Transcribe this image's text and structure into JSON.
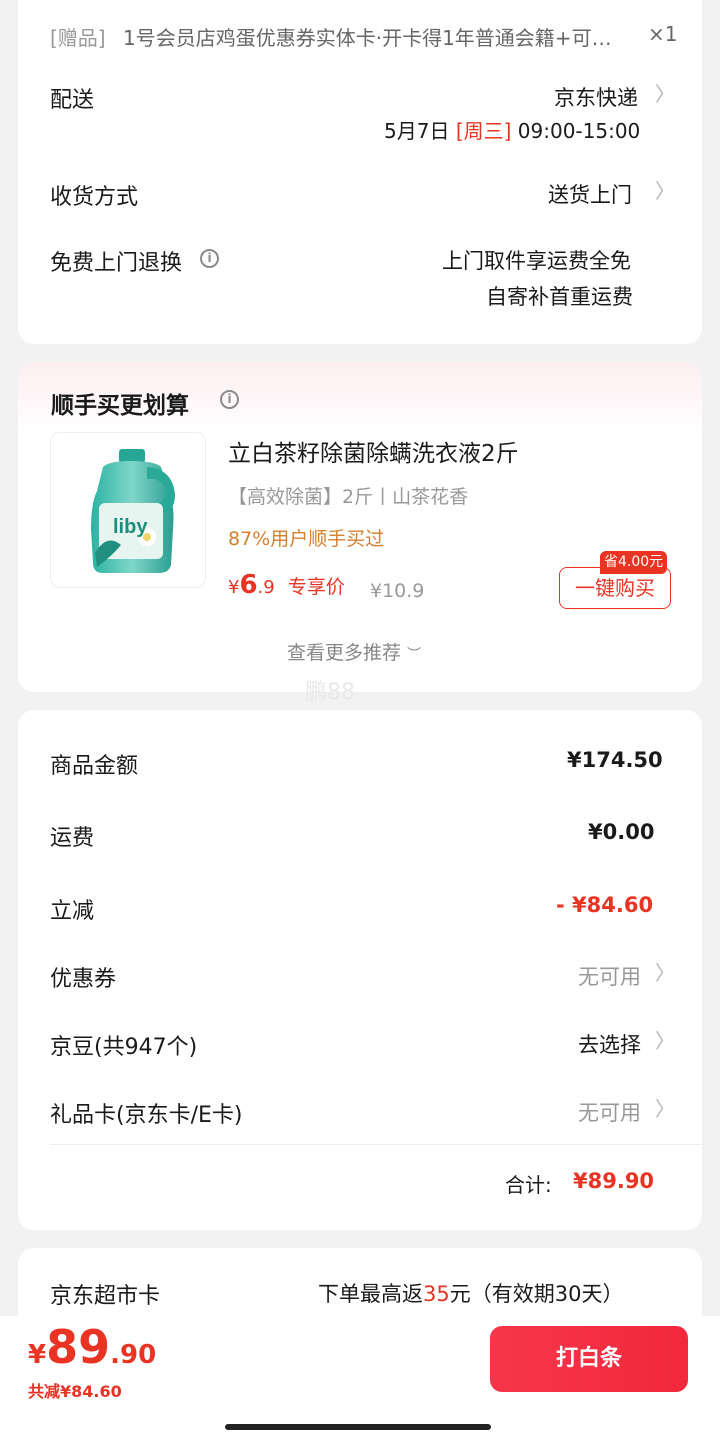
{
  "gift": {
    "tag": "[赠品]",
    "text": "1号会员店鸡蛋优惠券实体卡·开卡得1年普通会籍+可…",
    "qty": "×1"
  },
  "delivery": {
    "label": "配送",
    "carrier": "京东快递",
    "date": "5月7日",
    "weekday": "[周三]",
    "time": "09:00-15:00"
  },
  "receive": {
    "label": "收货方式",
    "value": "送货上门"
  },
  "free_return": {
    "label": "免费上门退换",
    "line1": "上门取件享运费全免",
    "line2": "自寄补首重运费"
  },
  "upsell": {
    "title": "顺手买更划算",
    "product_name": "立白茶籽除菌除螨洗衣液2斤",
    "product_tags": "【高效除菌】2斤丨山茶花香",
    "bought_text": "87%用户顺手买过",
    "price_symbol": "¥",
    "price_int": "6",
    "price_dec": ".9",
    "price_label": "专享价",
    "orig_price": "¥10.9",
    "save_tag": "省4.00元",
    "buy_button": "一键购买",
    "more": "查看更多推荐",
    "brand": "liby"
  },
  "watermark": "鹏88",
  "summary": {
    "goods_label": "商品金额",
    "goods_value": "¥174.50",
    "shipping_label": "运费",
    "shipping_value": "¥0.00",
    "discount_label": "立减",
    "discount_value": "- ¥84.60",
    "coupon_label": "优惠券",
    "coupon_value": "无可用",
    "beans_label": "京豆(共947个)",
    "beans_value": "去选择",
    "giftcard_label": "礼品卡(京东卡/E卡)",
    "giftcard_value": "无可用",
    "total_label": "合计:",
    "total_value": "¥89.90"
  },
  "market_card": {
    "label": "京东超市卡",
    "text_pre": "下单最高返",
    "amount": "35",
    "text_post": "元（有效期30天）"
  },
  "footer": {
    "price_symbol": "¥",
    "price_int": "89",
    "price_dec": ".90",
    "saved": "共减¥84.60",
    "pay_button": "打白条"
  },
  "colors": {
    "accent_red": "#e93323",
    "orange": "#d4802c",
    "button_red": "#f2283c"
  }
}
